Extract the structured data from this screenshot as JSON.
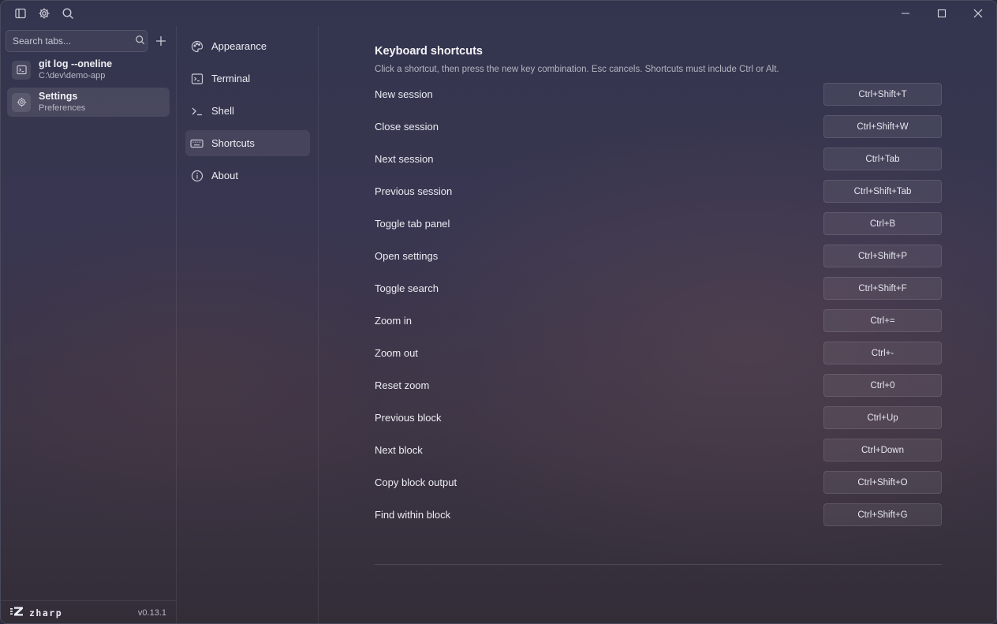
{
  "titlebar": {
    "icons": [
      "sidebar-toggle-icon",
      "gear-icon",
      "search-icon"
    ],
    "window_controls": [
      "minimize-icon",
      "maximize-icon",
      "close-icon"
    ]
  },
  "tab_panel": {
    "search": {
      "placeholder": "Search tabs..."
    },
    "tabs": [
      {
        "title": "git log --oneline",
        "subtitle": "C:\\dev\\demo-app",
        "icon": "terminal-icon",
        "active": false
      },
      {
        "title": "Settings",
        "subtitle": "Preferences",
        "icon": "gear-icon",
        "active": true
      }
    ],
    "footer": {
      "brand": "zharp",
      "version": "v0.13.1"
    }
  },
  "settings_nav": {
    "items": [
      {
        "label": "Appearance",
        "icon": "palette-icon",
        "active": false
      },
      {
        "label": "Terminal",
        "icon": "terminal-icon",
        "active": false
      },
      {
        "label": "Shell",
        "icon": "prompt-icon",
        "active": false
      },
      {
        "label": "Shortcuts",
        "icon": "keyboard-icon",
        "active": true
      },
      {
        "label": "About",
        "icon": "info-icon",
        "active": false
      }
    ]
  },
  "content": {
    "title": "Keyboard shortcuts",
    "description": "Click a shortcut, then press the new key combination. Esc cancels. Shortcuts must include Ctrl or Alt.",
    "shortcuts": [
      {
        "label": "New session",
        "keys": "Ctrl+Shift+T"
      },
      {
        "label": "Close session",
        "keys": "Ctrl+Shift+W"
      },
      {
        "label": "Next session",
        "keys": "Ctrl+Tab"
      },
      {
        "label": "Previous session",
        "keys": "Ctrl+Shift+Tab"
      },
      {
        "label": "Toggle tab panel",
        "keys": "Ctrl+B"
      },
      {
        "label": "Open settings",
        "keys": "Ctrl+Shift+P"
      },
      {
        "label": "Toggle search",
        "keys": "Ctrl+Shift+F"
      },
      {
        "label": "Zoom in",
        "keys": "Ctrl+="
      },
      {
        "label": "Zoom out",
        "keys": "Ctrl+-"
      },
      {
        "label": "Reset zoom",
        "keys": "Ctrl+0"
      },
      {
        "label": "Previous block",
        "keys": "Ctrl+Up"
      },
      {
        "label": "Next block",
        "keys": "Ctrl+Down"
      },
      {
        "label": "Copy block output",
        "keys": "Ctrl+Shift+O"
      },
      {
        "label": "Find within block",
        "keys": "Ctrl+Shift+G"
      }
    ]
  }
}
